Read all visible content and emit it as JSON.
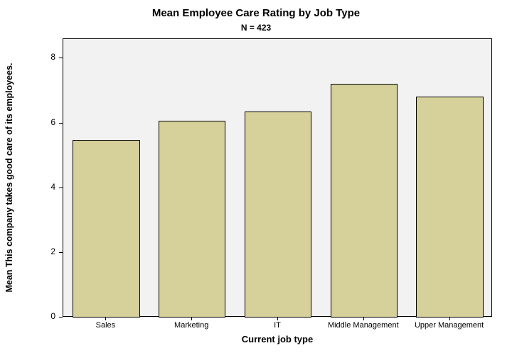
{
  "chart_data": {
    "type": "bar",
    "title": "Mean Employee Care Rating by Job Type",
    "subtitle": "N = 423",
    "xlabel": "Current job type",
    "ylabel": "Mean This company takes good care of its employees.",
    "categories": [
      "Sales",
      "Marketing",
      "IT",
      "Middle Management",
      "Upper Management"
    ],
    "values": [
      5.48,
      6.08,
      6.37,
      7.22,
      6.83
    ],
    "ylim": [
      0,
      8.6
    ],
    "yticks": [
      0,
      2,
      4,
      6,
      8
    ],
    "bar_color": "#d6d09b",
    "plot_bg": "#f2f2f2"
  }
}
